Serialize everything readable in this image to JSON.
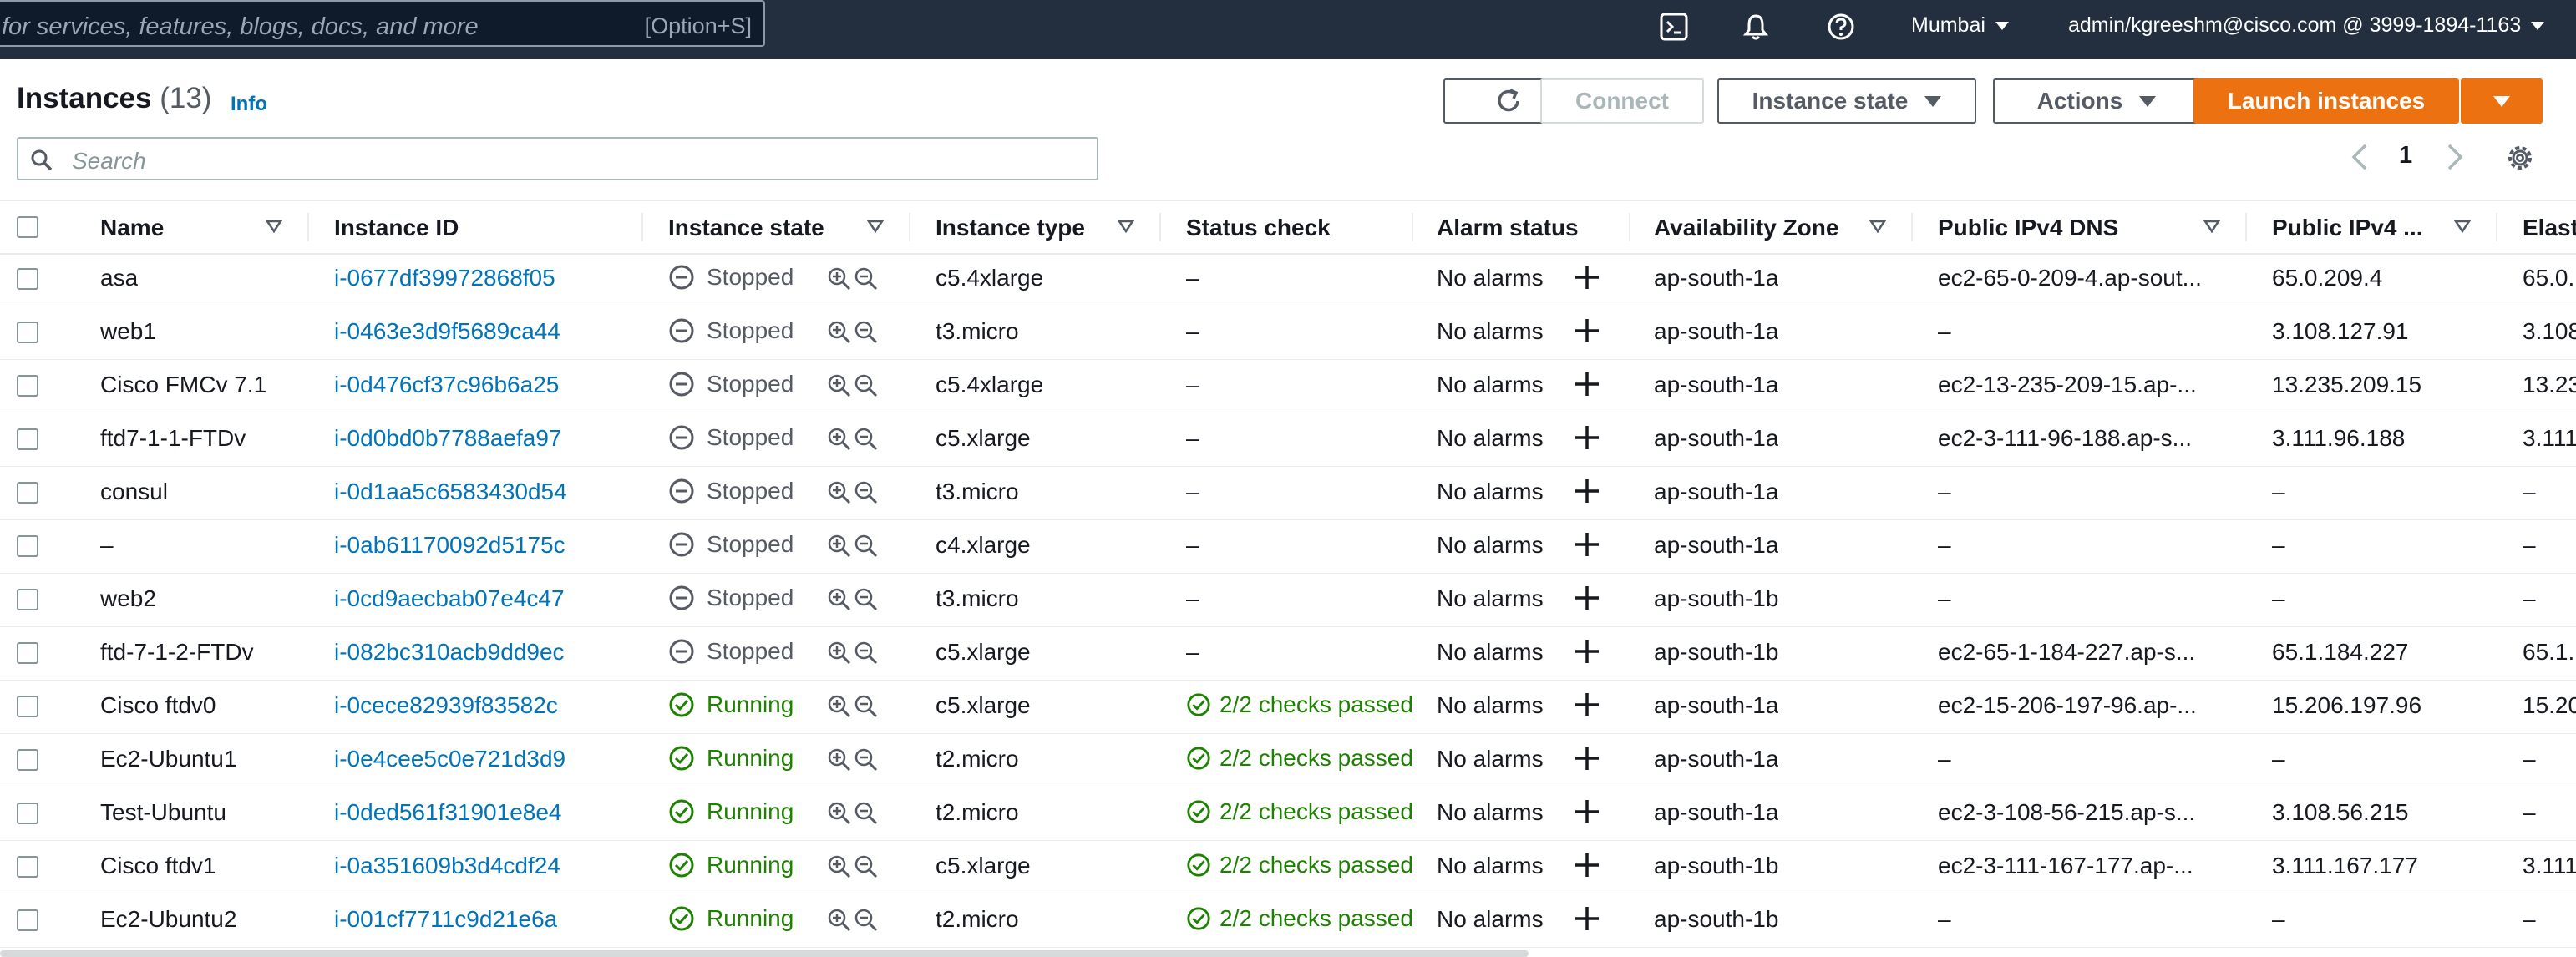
{
  "topbar": {
    "search_placeholder": "for services, features, blogs, docs, and more",
    "search_shortcut": "[Option+S]",
    "region": "Mumbai",
    "account": "admin/kgreeshm@cisco.com @ 3999-1894-1163",
    "icons": [
      "cloudshell-icon",
      "notifications-icon",
      "help-icon"
    ]
  },
  "header": {
    "title": "Instances",
    "count": "(13)",
    "info": "Info",
    "connect": "Connect",
    "instance_state": "Instance state",
    "actions": "Actions",
    "launch": "Launch instances"
  },
  "filter": {
    "placeholder": "Search"
  },
  "pagination": {
    "page": "1"
  },
  "columns": [
    "Name",
    "Instance ID",
    "Instance state",
    "Instance type",
    "Status check",
    "Alarm status",
    "Availability Zone",
    "Public IPv4 DNS",
    "Public IPv4 ...",
    "Elast"
  ],
  "colors": {
    "accent": "#ec7211",
    "link": "#0073bb",
    "running": "#1d8102",
    "stopped": "#545b64",
    "topbar": "#232f3e"
  },
  "rows": [
    {
      "name": "asa",
      "id": "i-0677df39972868f05",
      "state": "Stopped",
      "type": "c5.4xlarge",
      "status": "–",
      "alarm": "No alarms",
      "az": "ap-south-1a",
      "dns": "ec2-65-0-209-4.ap-sout...",
      "ip": "65.0.209.4",
      "elastic": "65.0."
    },
    {
      "name": "web1",
      "id": "i-0463e3d9f5689ca44",
      "state": "Stopped",
      "type": "t3.micro",
      "status": "–",
      "alarm": "No alarms",
      "az": "ap-south-1a",
      "dns": "–",
      "ip": "3.108.127.91",
      "elastic": "3.108"
    },
    {
      "name": "Cisco FMCv 7.1",
      "id": "i-0d476cf37c96b6a25",
      "state": "Stopped",
      "type": "c5.4xlarge",
      "status": "–",
      "alarm": "No alarms",
      "az": "ap-south-1a",
      "dns": "ec2-13-235-209-15.ap-...",
      "ip": "13.235.209.15",
      "elastic": "13.23"
    },
    {
      "name": "ftd7-1-1-FTDv",
      "id": "i-0d0bd0b7788aefa97",
      "state": "Stopped",
      "type": "c5.xlarge",
      "status": "–",
      "alarm": "No alarms",
      "az": "ap-south-1a",
      "dns": "ec2-3-111-96-188.ap-s...",
      "ip": "3.111.96.188",
      "elastic": "3.111"
    },
    {
      "name": "consul",
      "id": "i-0d1aa5c6583430d54",
      "state": "Stopped",
      "type": "t3.micro",
      "status": "–",
      "alarm": "No alarms",
      "az": "ap-south-1a",
      "dns": "–",
      "ip": "–",
      "elastic": "–"
    },
    {
      "name": "–",
      "id": "i-0ab61170092d5175c",
      "state": "Stopped",
      "type": "c4.xlarge",
      "status": "–",
      "alarm": "No alarms",
      "az": "ap-south-1a",
      "dns": "–",
      "ip": "–",
      "elastic": "–"
    },
    {
      "name": "web2",
      "id": "i-0cd9aecbab07e4c47",
      "state": "Stopped",
      "type": "t3.micro",
      "status": "–",
      "alarm": "No alarms",
      "az": "ap-south-1b",
      "dns": "–",
      "ip": "–",
      "elastic": "–"
    },
    {
      "name": "ftd-7-1-2-FTDv",
      "id": "i-082bc310acb9dd9ec",
      "state": "Stopped",
      "type": "c5.xlarge",
      "status": "–",
      "alarm": "No alarms",
      "az": "ap-south-1b",
      "dns": "ec2-65-1-184-227.ap-s...",
      "ip": "65.1.184.227",
      "elastic": "65.1."
    },
    {
      "name": "Cisco ftdv0",
      "id": "i-0cece82939f83582c",
      "state": "Running",
      "type": "c5.xlarge",
      "status": "2/2 checks passed",
      "alarm": "No alarms",
      "az": "ap-south-1a",
      "dns": "ec2-15-206-197-96.ap-...",
      "ip": "15.206.197.96",
      "elastic": "15.20"
    },
    {
      "name": "Ec2-Ubuntu1",
      "id": "i-0e4cee5c0e721d3d9",
      "state": "Running",
      "type": "t2.micro",
      "status": "2/2 checks passed",
      "alarm": "No alarms",
      "az": "ap-south-1a",
      "dns": "–",
      "ip": "–",
      "elastic": "–"
    },
    {
      "name": "Test-Ubuntu",
      "id": "i-0ded561f31901e8e4",
      "state": "Running",
      "type": "t2.micro",
      "status": "2/2 checks passed",
      "alarm": "No alarms",
      "az": "ap-south-1a",
      "dns": "ec2-3-108-56-215.ap-s...",
      "ip": "3.108.56.215",
      "elastic": "–"
    },
    {
      "name": "Cisco ftdv1",
      "id": "i-0a351609b3d4cdf24",
      "state": "Running",
      "type": "c5.xlarge",
      "status": "2/2 checks passed",
      "alarm": "No alarms",
      "az": "ap-south-1b",
      "dns": "ec2-3-111-167-177.ap-...",
      "ip": "3.111.167.177",
      "elastic": "3.111"
    },
    {
      "name": "Ec2-Ubuntu2",
      "id": "i-001cf7711c9d21e6a",
      "state": "Running",
      "type": "t2.micro",
      "status": "2/2 checks passed",
      "alarm": "No alarms",
      "az": "ap-south-1b",
      "dns": "–",
      "ip": "–",
      "elastic": "–"
    }
  ]
}
